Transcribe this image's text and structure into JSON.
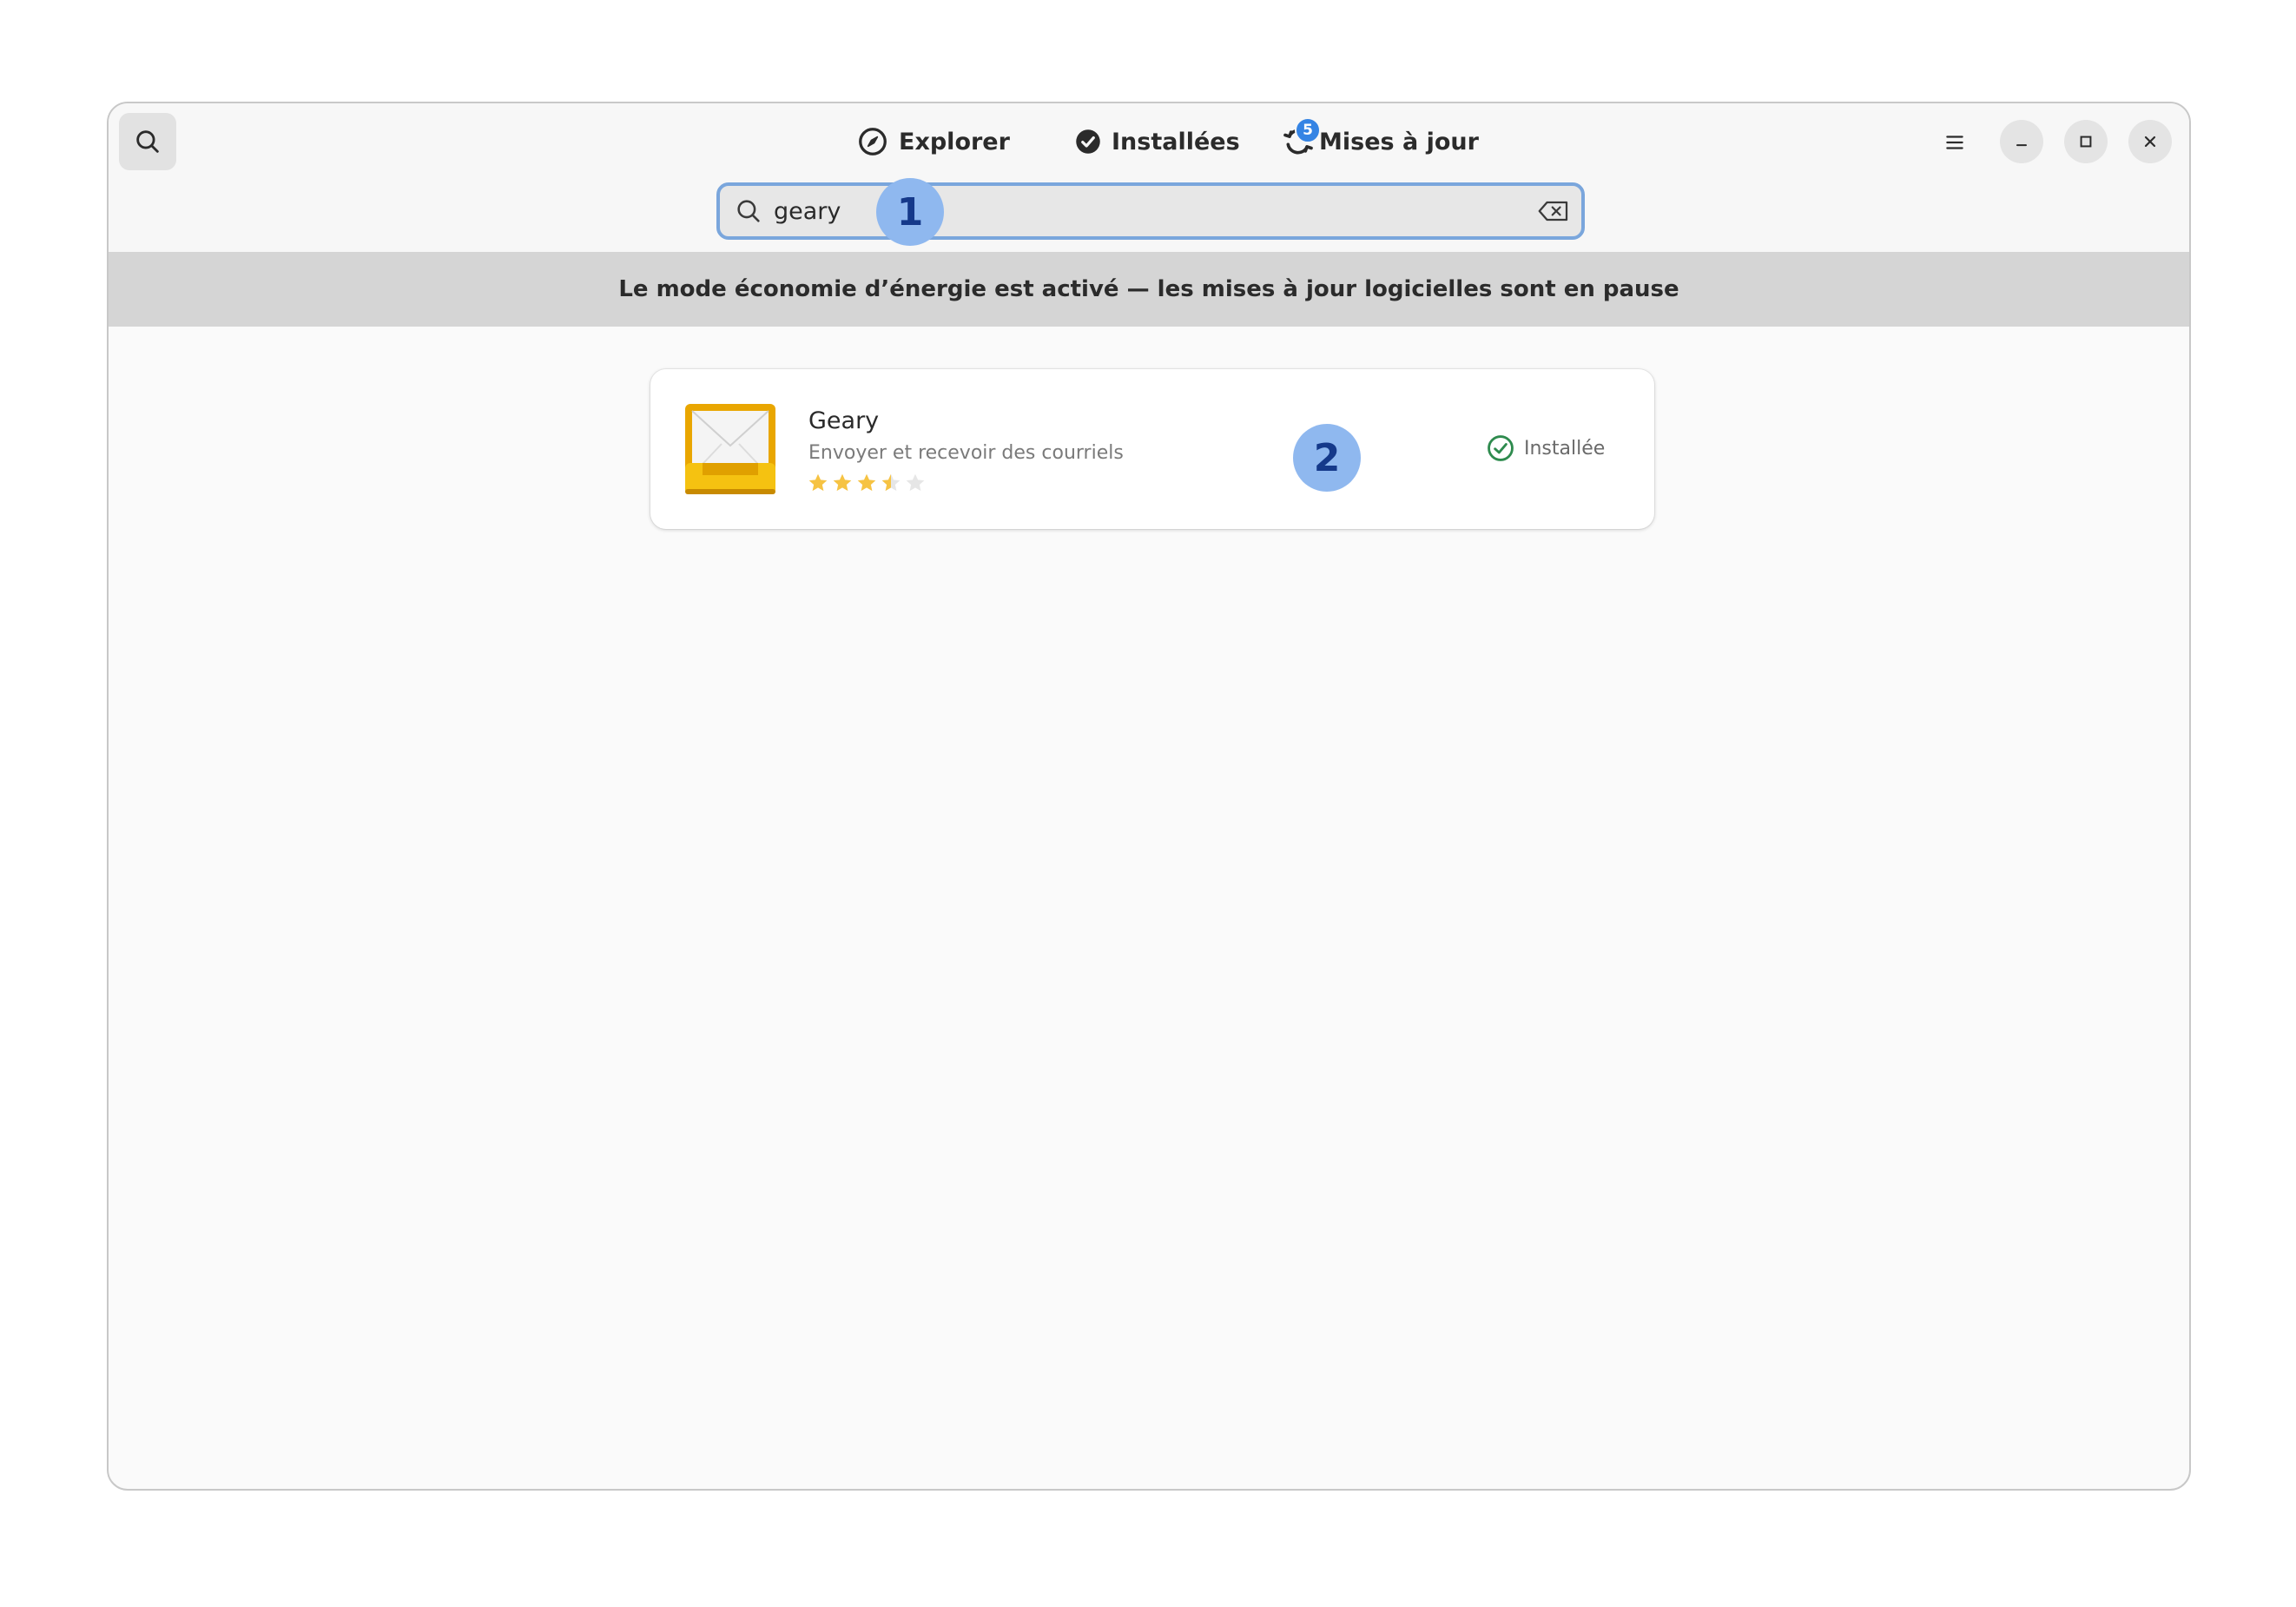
{
  "header": {
    "tabs": [
      {
        "label": "Explorer",
        "icon": "compass-icon"
      },
      {
        "label": "Installées",
        "icon": "check-circle-icon"
      },
      {
        "label": "Mises à jour",
        "icon": "refresh-icon",
        "badge": "5"
      }
    ]
  },
  "search": {
    "value": "geary"
  },
  "banner": {
    "text": "Le mode économie d’énergie est activé — les mises à jour logicielles sont en pause"
  },
  "results": [
    {
      "name": "Geary",
      "description": "Envoyer et recevoir des courriels",
      "rating": 3.5,
      "rating_max": 5,
      "status": "Installée"
    }
  ],
  "markers": [
    "1",
    "2"
  ],
  "colors": {
    "accent": "#3584e4",
    "installed_green": "#2e8b4e",
    "star": "#f6c343",
    "star_empty": "#e6e6e6",
    "marker": "#8fb8ef",
    "banner": "#d5d5d5"
  }
}
